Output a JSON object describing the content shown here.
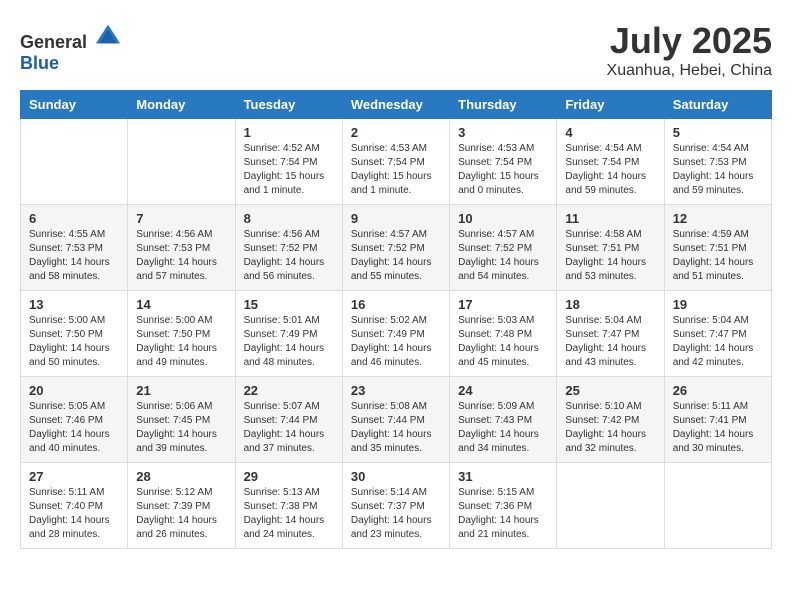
{
  "header": {
    "logo_general": "General",
    "logo_blue": "Blue",
    "month_year": "July 2025",
    "location": "Xuanhua, Hebei, China"
  },
  "days_of_week": [
    "Sunday",
    "Monday",
    "Tuesday",
    "Wednesday",
    "Thursday",
    "Friday",
    "Saturday"
  ],
  "weeks": [
    [
      {
        "day": "",
        "sunrise": "",
        "sunset": "",
        "daylight": ""
      },
      {
        "day": "",
        "sunrise": "",
        "sunset": "",
        "daylight": ""
      },
      {
        "day": "1",
        "sunrise": "Sunrise: 4:52 AM",
        "sunset": "Sunset: 7:54 PM",
        "daylight": "Daylight: 15 hours and 1 minute."
      },
      {
        "day": "2",
        "sunrise": "Sunrise: 4:53 AM",
        "sunset": "Sunset: 7:54 PM",
        "daylight": "Daylight: 15 hours and 1 minute."
      },
      {
        "day": "3",
        "sunrise": "Sunrise: 4:53 AM",
        "sunset": "Sunset: 7:54 PM",
        "daylight": "Daylight: 15 hours and 0 minutes."
      },
      {
        "day": "4",
        "sunrise": "Sunrise: 4:54 AM",
        "sunset": "Sunset: 7:54 PM",
        "daylight": "Daylight: 14 hours and 59 minutes."
      },
      {
        "day": "5",
        "sunrise": "Sunrise: 4:54 AM",
        "sunset": "Sunset: 7:53 PM",
        "daylight": "Daylight: 14 hours and 59 minutes."
      }
    ],
    [
      {
        "day": "6",
        "sunrise": "Sunrise: 4:55 AM",
        "sunset": "Sunset: 7:53 PM",
        "daylight": "Daylight: 14 hours and 58 minutes."
      },
      {
        "day": "7",
        "sunrise": "Sunrise: 4:56 AM",
        "sunset": "Sunset: 7:53 PM",
        "daylight": "Daylight: 14 hours and 57 minutes."
      },
      {
        "day": "8",
        "sunrise": "Sunrise: 4:56 AM",
        "sunset": "Sunset: 7:52 PM",
        "daylight": "Daylight: 14 hours and 56 minutes."
      },
      {
        "day": "9",
        "sunrise": "Sunrise: 4:57 AM",
        "sunset": "Sunset: 7:52 PM",
        "daylight": "Daylight: 14 hours and 55 minutes."
      },
      {
        "day": "10",
        "sunrise": "Sunrise: 4:57 AM",
        "sunset": "Sunset: 7:52 PM",
        "daylight": "Daylight: 14 hours and 54 minutes."
      },
      {
        "day": "11",
        "sunrise": "Sunrise: 4:58 AM",
        "sunset": "Sunset: 7:51 PM",
        "daylight": "Daylight: 14 hours and 53 minutes."
      },
      {
        "day": "12",
        "sunrise": "Sunrise: 4:59 AM",
        "sunset": "Sunset: 7:51 PM",
        "daylight": "Daylight: 14 hours and 51 minutes."
      }
    ],
    [
      {
        "day": "13",
        "sunrise": "Sunrise: 5:00 AM",
        "sunset": "Sunset: 7:50 PM",
        "daylight": "Daylight: 14 hours and 50 minutes."
      },
      {
        "day": "14",
        "sunrise": "Sunrise: 5:00 AM",
        "sunset": "Sunset: 7:50 PM",
        "daylight": "Daylight: 14 hours and 49 minutes."
      },
      {
        "day": "15",
        "sunrise": "Sunrise: 5:01 AM",
        "sunset": "Sunset: 7:49 PM",
        "daylight": "Daylight: 14 hours and 48 minutes."
      },
      {
        "day": "16",
        "sunrise": "Sunrise: 5:02 AM",
        "sunset": "Sunset: 7:49 PM",
        "daylight": "Daylight: 14 hours and 46 minutes."
      },
      {
        "day": "17",
        "sunrise": "Sunrise: 5:03 AM",
        "sunset": "Sunset: 7:48 PM",
        "daylight": "Daylight: 14 hours and 45 minutes."
      },
      {
        "day": "18",
        "sunrise": "Sunrise: 5:04 AM",
        "sunset": "Sunset: 7:47 PM",
        "daylight": "Daylight: 14 hours and 43 minutes."
      },
      {
        "day": "19",
        "sunrise": "Sunrise: 5:04 AM",
        "sunset": "Sunset: 7:47 PM",
        "daylight": "Daylight: 14 hours and 42 minutes."
      }
    ],
    [
      {
        "day": "20",
        "sunrise": "Sunrise: 5:05 AM",
        "sunset": "Sunset: 7:46 PM",
        "daylight": "Daylight: 14 hours and 40 minutes."
      },
      {
        "day": "21",
        "sunrise": "Sunrise: 5:06 AM",
        "sunset": "Sunset: 7:45 PM",
        "daylight": "Daylight: 14 hours and 39 minutes."
      },
      {
        "day": "22",
        "sunrise": "Sunrise: 5:07 AM",
        "sunset": "Sunset: 7:44 PM",
        "daylight": "Daylight: 14 hours and 37 minutes."
      },
      {
        "day": "23",
        "sunrise": "Sunrise: 5:08 AM",
        "sunset": "Sunset: 7:44 PM",
        "daylight": "Daylight: 14 hours and 35 minutes."
      },
      {
        "day": "24",
        "sunrise": "Sunrise: 5:09 AM",
        "sunset": "Sunset: 7:43 PM",
        "daylight": "Daylight: 14 hours and 34 minutes."
      },
      {
        "day": "25",
        "sunrise": "Sunrise: 5:10 AM",
        "sunset": "Sunset: 7:42 PM",
        "daylight": "Daylight: 14 hours and 32 minutes."
      },
      {
        "day": "26",
        "sunrise": "Sunrise: 5:11 AM",
        "sunset": "Sunset: 7:41 PM",
        "daylight": "Daylight: 14 hours and 30 minutes."
      }
    ],
    [
      {
        "day": "27",
        "sunrise": "Sunrise: 5:11 AM",
        "sunset": "Sunset: 7:40 PM",
        "daylight": "Daylight: 14 hours and 28 minutes."
      },
      {
        "day": "28",
        "sunrise": "Sunrise: 5:12 AM",
        "sunset": "Sunset: 7:39 PM",
        "daylight": "Daylight: 14 hours and 26 minutes."
      },
      {
        "day": "29",
        "sunrise": "Sunrise: 5:13 AM",
        "sunset": "Sunset: 7:38 PM",
        "daylight": "Daylight: 14 hours and 24 minutes."
      },
      {
        "day": "30",
        "sunrise": "Sunrise: 5:14 AM",
        "sunset": "Sunset: 7:37 PM",
        "daylight": "Daylight: 14 hours and 23 minutes."
      },
      {
        "day": "31",
        "sunrise": "Sunrise: 5:15 AM",
        "sunset": "Sunset: 7:36 PM",
        "daylight": "Daylight: 14 hours and 21 minutes."
      },
      {
        "day": "",
        "sunrise": "",
        "sunset": "",
        "daylight": ""
      },
      {
        "day": "",
        "sunrise": "",
        "sunset": "",
        "daylight": ""
      }
    ]
  ]
}
